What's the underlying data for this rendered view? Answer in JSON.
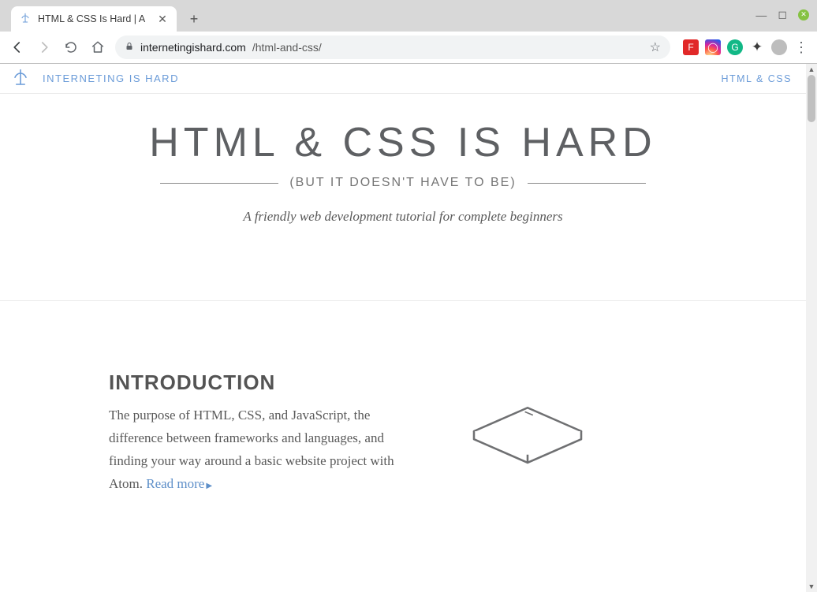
{
  "browser": {
    "tab_title": "HTML & CSS Is Hard | A",
    "url_host": "internetingishard.com",
    "url_path": "/html-and-css/"
  },
  "site_header": {
    "brand": "INTERNETING IS HARD",
    "nav_link": "HTML & CSS"
  },
  "hero": {
    "title": "HTML & CSS IS HARD",
    "subtitle": "(BUT IT DOESN'T HAVE TO BE)",
    "tagline": "A friendly web development tutorial for complete beginners"
  },
  "intro": {
    "heading": "INTRODUCTION",
    "body": "The purpose of HTML, CSS, and JavaScript, the difference between frameworks and languages, and finding your way around a basic website project with Atom. ",
    "readmore_label": "Read more"
  }
}
